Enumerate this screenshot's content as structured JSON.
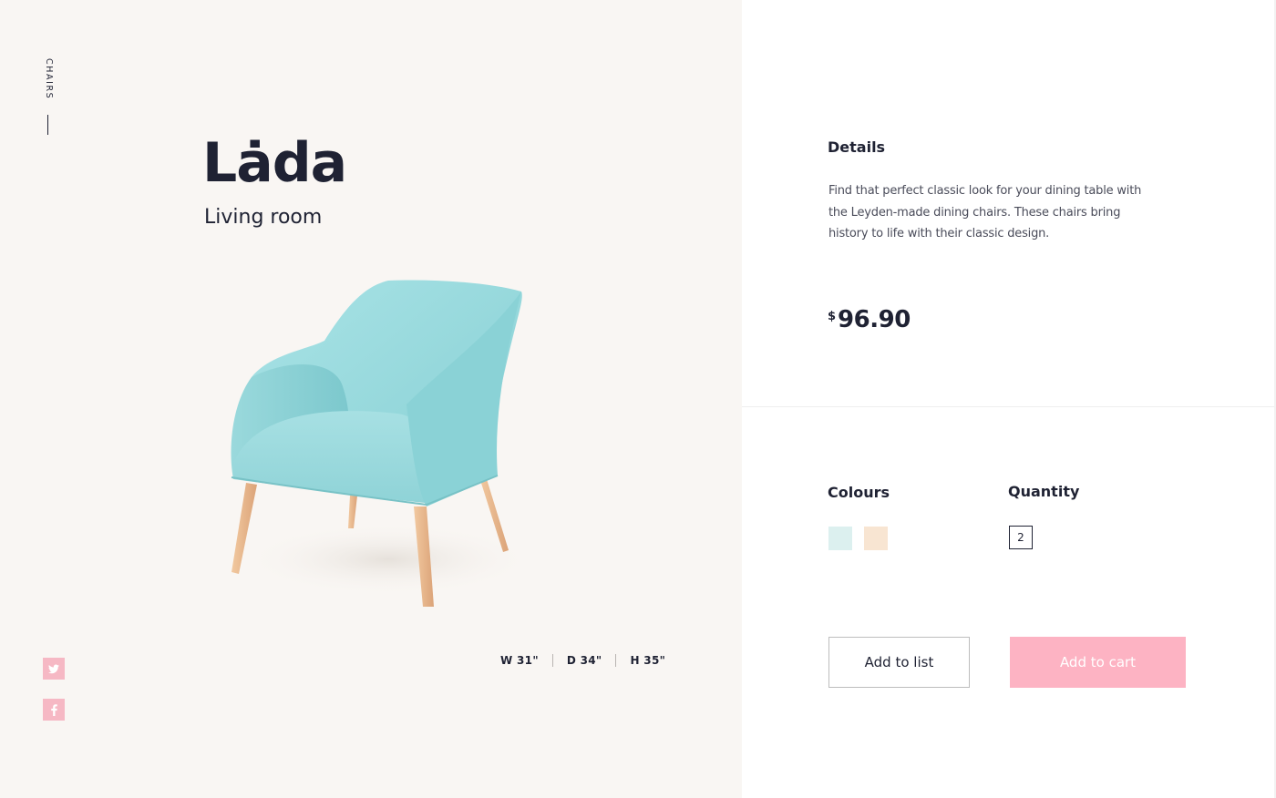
{
  "category": {
    "label": "CHAIRS"
  },
  "product": {
    "name": "Lȧda",
    "room": "Living room",
    "dimensions": [
      {
        "label": "W 31\""
      },
      {
        "label": "D 34\""
      },
      {
        "label": "H 35\""
      }
    ]
  },
  "details": {
    "heading": "Details",
    "description": "Find that perfect classic look for your dining table with the Leyden-made dining chairs. These chairs bring history to life with their classic design."
  },
  "price": {
    "currency": "$",
    "amount": "96.90"
  },
  "colours": {
    "heading": "Colours",
    "options": [
      {
        "name": "mint",
        "hex": "#dcf0ef"
      },
      {
        "name": "peach",
        "hex": "#f8e5d2"
      }
    ]
  },
  "quantity": {
    "heading": "Quantity",
    "value": "2"
  },
  "actions": {
    "add_to_list": "Add to list",
    "add_to_cart": "Add to cart"
  },
  "social": [
    {
      "icon": "twitter-icon"
    },
    {
      "icon": "facebook-icon"
    }
  ],
  "theme": {
    "left_bg": "#f9f6f3",
    "accent_pink": "#fdb3c3",
    "text_dark": "#1f2233",
    "chair_color": "#9fdde0"
  }
}
